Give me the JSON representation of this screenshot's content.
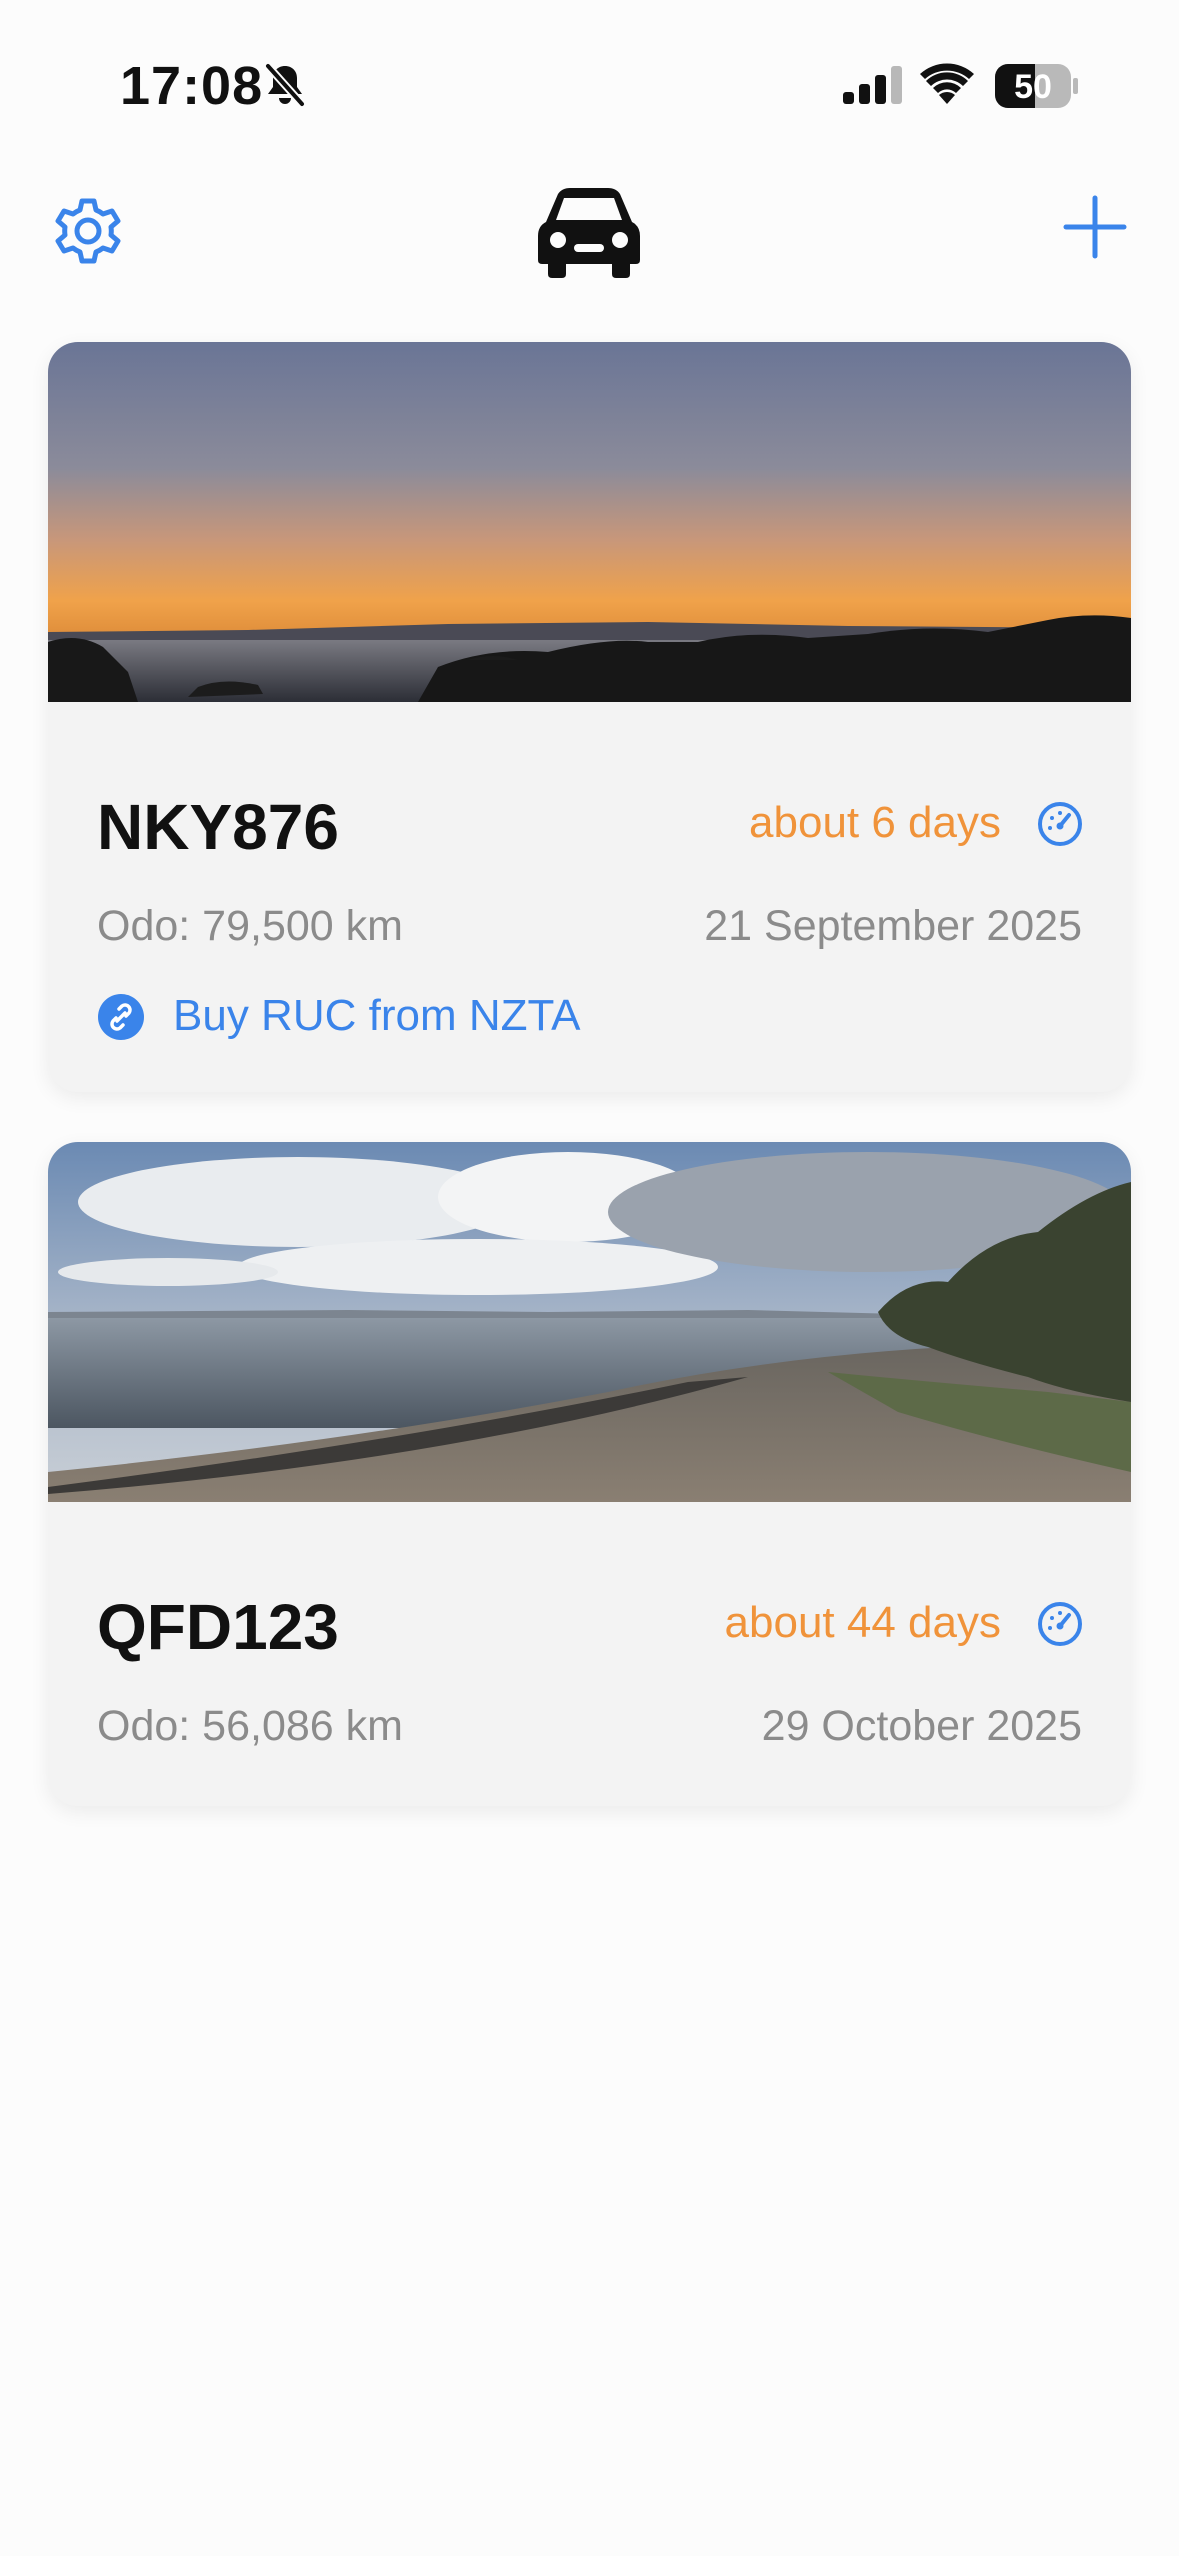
{
  "status_bar": {
    "time": "17:08",
    "battery": "50",
    "icons": [
      "bell-slash-icon",
      "cellular-signal-icon",
      "wifi-icon",
      "battery-icon"
    ]
  },
  "nav": {
    "settings_icon": "gear-icon",
    "logo_icon": "car-icon",
    "add_icon": "plus-icon",
    "accent_color": "#3a84ea"
  },
  "vehicles": [
    {
      "plate": "NKY876",
      "due": "about 6 days",
      "odometer": "Odo: 79,500 km",
      "date": "21 September 2025",
      "link_label": "Buy RUC from NZTA",
      "photo": "sunset-coastline-photo",
      "due_color": "#f0933a"
    },
    {
      "plate": "QFD123",
      "due": "about 44 days",
      "odometer": "Odo: 56,086 km",
      "date": "29 October 2025",
      "photo": "beach-shoreline-photo",
      "due_color": "#f0933a"
    }
  ]
}
